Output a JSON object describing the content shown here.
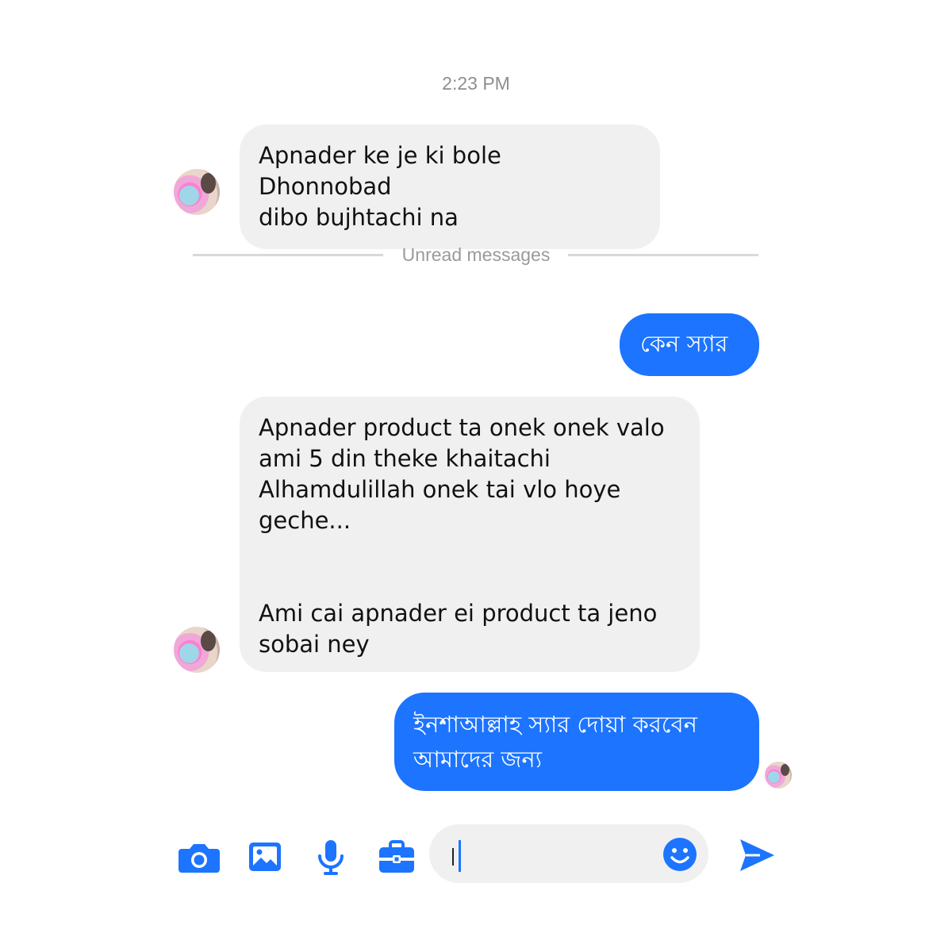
{
  "conversation": {
    "timestamp": "2:23 PM",
    "unread_divider": "Unread messages",
    "messages": [
      {
        "direction": "incoming",
        "text": "Apnader ke je ki bole Dhonnobad\ndibo bujhtachi na"
      },
      {
        "direction": "outgoing",
        "text": "কেন স্যার"
      },
      {
        "direction": "incoming",
        "text": "Apnader product ta onek onek valo\nami 5 din theke khaitachi\nAlhamdulillah onek tai vlo hoye\ngeche...\n\n\nAmi cai apnader ei product ta jeno\nsobai ney"
      },
      {
        "direction": "outgoing",
        "text": "ইনশাআল্লাহ স্যার দোয়া করবেন\nআমাদের জন্য"
      }
    ]
  },
  "composer": {
    "input_value": "",
    "tools": [
      "camera-icon",
      "image-icon",
      "microphone-icon",
      "briefcase-icon"
    ],
    "emoji_icon": "smiley-icon",
    "send_icon": "send-icon"
  },
  "colors": {
    "accent": "#1c74ff",
    "incoming_bubble": "#f0f0f0",
    "meta_text": "#8e8e93"
  }
}
